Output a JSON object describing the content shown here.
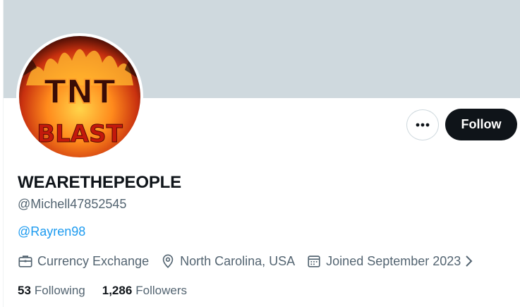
{
  "profile": {
    "display_name": "WEARETHEPEOPLE",
    "handle": "@Michell47852545",
    "bio_link": "@Rayren98",
    "avatar_text_top": "TNT",
    "avatar_text_bottom": "BLAST"
  },
  "actions": {
    "more_icon": "more-horizontal-icon",
    "follow_label": "Follow"
  },
  "meta": {
    "category": "Currency Exchange",
    "category_icon": "briefcase-icon",
    "location": "North Carolina, USA",
    "location_icon": "location-pin-icon",
    "joined": "Joined September 2023",
    "joined_icon": "calendar-icon"
  },
  "stats": {
    "following_count": "53",
    "following_label": "Following",
    "followers_count": "1,286",
    "followers_label": "Followers"
  },
  "colors": {
    "banner": "#cfd9de",
    "link": "#1d9bf0",
    "secondary_text": "#536471",
    "primary_text": "#0f1419"
  }
}
